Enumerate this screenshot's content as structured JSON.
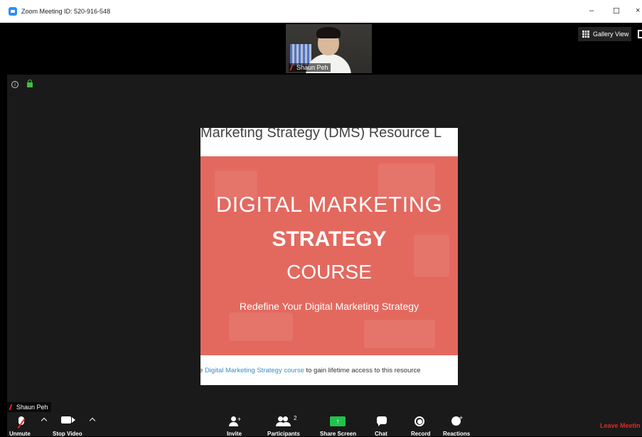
{
  "window": {
    "title": "Zoom Meeting ID: 520-916-548",
    "minimize": "–",
    "maximize": "☐",
    "close": "×"
  },
  "top_strip": {
    "participant_name": "Shaun Peh",
    "gallery_view_label": "Gallery View"
  },
  "share": {
    "header_text": "Marketing Strategy (DMS) Resource L",
    "line1": "DIGITAL MARKETING",
    "line2": "STRATEGY",
    "line3": "COURSE",
    "line4": "Redefine Your Digital Marketing Strategy",
    "footer_prefix": "e ",
    "footer_link": "Digital Marketing Strategy course",
    "footer_suffix": " to gain lifetime access to this resource"
  },
  "self_view": {
    "name": "Shaun Peh"
  },
  "toolbar": {
    "unmute": "Unmute",
    "stop_video": "Stop Video",
    "invite": "Invite",
    "participants": "Participants",
    "participants_count": "2",
    "share_screen": "Share Screen",
    "chat": "Chat",
    "record": "Record",
    "reactions": "Reactions",
    "leave": "Leave Meetin"
  },
  "colors": {
    "banner": "#e3695f",
    "share_green": "#21c44a",
    "leave_red": "#e02828",
    "lock_green": "#3ec03e",
    "link_blue": "#3a8fc7"
  }
}
